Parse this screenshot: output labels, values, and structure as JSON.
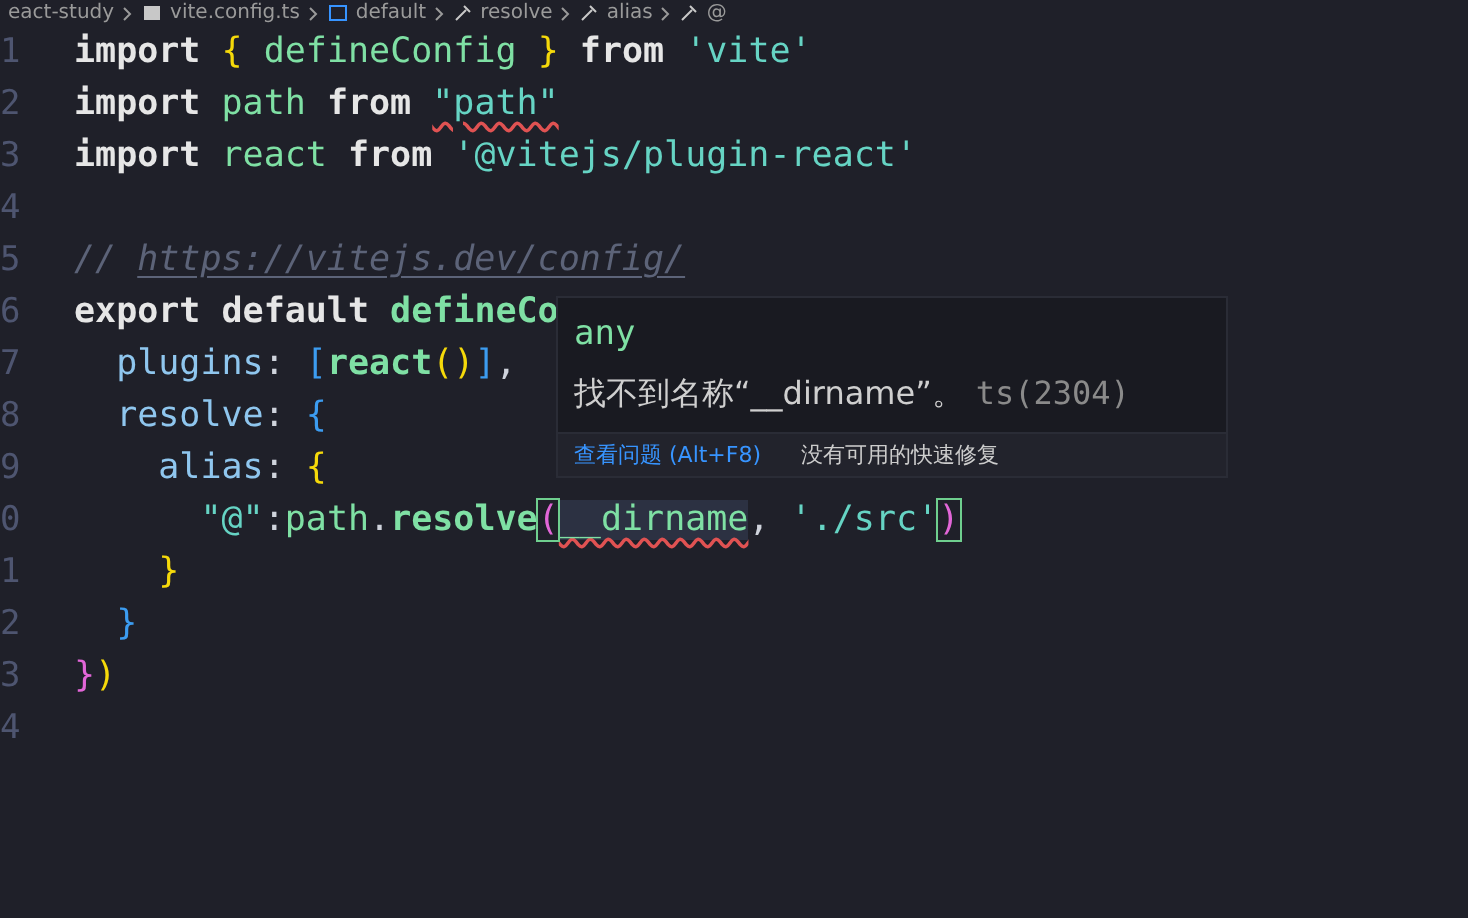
{
  "breadcrumb": [
    {
      "label": "eact-study",
      "kind": "folder"
    },
    {
      "label": "vite.config.ts",
      "kind": "file"
    },
    {
      "label": "default",
      "kind": "variable"
    },
    {
      "label": "resolve",
      "kind": "property"
    },
    {
      "label": "alias",
      "kind": "property"
    },
    {
      "label": "@",
      "kind": "property"
    }
  ],
  "lines": [
    {
      "number": "1",
      "tokens": [
        {
          "text": "import ",
          "kind": "keyword"
        },
        {
          "text": "{",
          "kind": "brace1"
        },
        {
          "text": " defineConfig ",
          "kind": "var"
        },
        {
          "text": "} ",
          "kind": "brace1"
        },
        {
          "text": "from",
          "kind": "keyword"
        },
        {
          "text": " 'vite'",
          "kind": "string"
        }
      ]
    },
    {
      "number": "2",
      "tokens": [
        {
          "text": "import",
          "kind": "keyword"
        },
        {
          "text": " path ",
          "kind": "var"
        },
        {
          "text": "from ",
          "kind": "keyword"
        },
        {
          "text": "\"path\"",
          "kind": "error-string"
        }
      ]
    },
    {
      "number": "3",
      "tokens": [
        {
          "text": "import",
          "kind": "keyword"
        },
        {
          "text": " react ",
          "kind": "var"
        },
        {
          "text": "from",
          "kind": "keyword"
        },
        {
          "text": " '@vitejs/plugin-react'",
          "kind": "string"
        }
      ]
    },
    {
      "number": "4"
    },
    {
      "number": "5",
      "tokens": [
        {
          "text": "// ",
          "kind": "comment"
        },
        {
          "text": "https://vitejs.dev/config/",
          "kind": "link"
        }
      ]
    },
    {
      "number": "6",
      "tokens": [
        {
          "text": "export default ",
          "kind": "keyword"
        },
        {
          "text": "defineCo",
          "kind": "func"
        }
      ]
    },
    {
      "number": "7",
      "tokens": [
        {
          "text": "  plugins",
          "kind": "prop"
        },
        {
          "text": ": ",
          "kind": "punct"
        },
        {
          "text": "[",
          "kind": "brace3"
        },
        {
          "text": "react",
          "kind": "func"
        },
        {
          "text": "()",
          "kind": "brace1"
        },
        {
          "text": "]",
          "kind": "brace3"
        },
        {
          "text": ",",
          "kind": "punct"
        }
      ]
    },
    {
      "number": "8",
      "tokens": [
        {
          "text": "  resolve",
          "kind": "prop"
        },
        {
          "text": ": ",
          "kind": "punct"
        },
        {
          "text": "{",
          "kind": "brace3"
        }
      ]
    },
    {
      "number": "9",
      "tokens": [
        {
          "text": "    alias",
          "kind": "prop"
        },
        {
          "text": ": ",
          "kind": "punct"
        },
        {
          "text": "{",
          "kind": "brace1"
        }
      ]
    },
    {
      "number": "0",
      "tokens": [
        {
          "text": "      \"@\"",
          "kind": "string"
        },
        {
          "text": ":",
          "kind": "punct"
        },
        {
          "text": "path",
          "kind": "var"
        },
        {
          "text": ".",
          "kind": "punct"
        },
        {
          "text": "resolve",
          "kind": "func"
        },
        {
          "text": "(",
          "kind": "bracket-match"
        },
        {
          "text": "__dirname",
          "kind": "error-var"
        },
        {
          "text": ", ",
          "kind": "punct"
        },
        {
          "text": "'./src'",
          "kind": "string"
        },
        {
          "text": ")",
          "kind": "bracket-match"
        }
      ]
    },
    {
      "number": "1",
      "tokens": [
        {
          "text": "    }",
          "kind": "brace1"
        }
      ]
    },
    {
      "number": "2",
      "tokens": [
        {
          "text": "  }",
          "kind": "brace3"
        }
      ]
    },
    {
      "number": "3",
      "tokens": [
        {
          "text": "}",
          "kind": "brace2"
        },
        {
          "text": ")",
          "kind": "brace1"
        }
      ]
    },
    {
      "number": "4"
    }
  ],
  "hover": {
    "type": "any",
    "message": "找不到名称“__dirname”。",
    "code": "ts(2304)",
    "actions": [
      {
        "label": "查看问题 (Alt+F8)",
        "kind": "link"
      },
      {
        "label": "没有可用的快速修复",
        "kind": "text"
      }
    ]
  }
}
